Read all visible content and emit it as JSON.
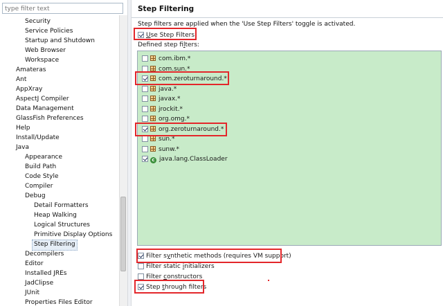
{
  "filter": {
    "placeholder": "type filter text"
  },
  "tree": {
    "items": [
      {
        "label": "Security",
        "level": 2
      },
      {
        "label": "Service Policies",
        "level": 2
      },
      {
        "label": "Startup and Shutdown",
        "level": 2
      },
      {
        "label": "Web Browser",
        "level": 2
      },
      {
        "label": "Workspace",
        "level": 2
      },
      {
        "label": "Amateras",
        "level": 1
      },
      {
        "label": "Ant",
        "level": 1
      },
      {
        "label": "AppXray",
        "level": 1
      },
      {
        "label": "AspectJ Compiler",
        "level": 1
      },
      {
        "label": "Data Management",
        "level": 1
      },
      {
        "label": "GlassFish Preferences",
        "level": 1
      },
      {
        "label": "Help",
        "level": 1
      },
      {
        "label": "Install/Update",
        "level": 1
      },
      {
        "label": "Java",
        "level": 1
      },
      {
        "label": "Appearance",
        "level": 2
      },
      {
        "label": "Build Path",
        "level": 2
      },
      {
        "label": "Code Style",
        "level": 2
      },
      {
        "label": "Compiler",
        "level": 2
      },
      {
        "label": "Debug",
        "level": 2
      },
      {
        "label": "Detail Formatters",
        "level": 3
      },
      {
        "label": "Heap Walking",
        "level": 3
      },
      {
        "label": "Logical Structures",
        "level": 3
      },
      {
        "label": "Primitive Display Options",
        "level": 3
      },
      {
        "label": "Step Filtering",
        "level": 3,
        "selected": true
      },
      {
        "label": "Decompilers",
        "level": 2
      },
      {
        "label": "Editor",
        "level": 2
      },
      {
        "label": "Installed JREs",
        "level": 2
      },
      {
        "label": "JadClipse",
        "level": 2
      },
      {
        "label": "JUnit",
        "level": 2
      },
      {
        "label": "Properties Files Editor",
        "level": 2
      }
    ]
  },
  "page": {
    "title": "Step Filtering",
    "description": "Step filters are applied when the 'Use Step Filters' toggle is activated.",
    "use_step_filters": {
      "pre": "",
      "ul": "U",
      "post": "se Step Filters",
      "checked": true
    },
    "defined_label": {
      "pre": "Defined step fi",
      "ul": "l",
      "post": "ters:"
    }
  },
  "filters": [
    {
      "label": "com.ibm.*",
      "checked": false,
      "icon": "package-icon"
    },
    {
      "label": "com.sun.*",
      "checked": false,
      "icon": "package-icon"
    },
    {
      "label": "com.zeroturnaround.*",
      "checked": true,
      "icon": "package-icon"
    },
    {
      "label": "java.*",
      "checked": false,
      "icon": "package-icon"
    },
    {
      "label": "javax.*",
      "checked": false,
      "icon": "package-icon"
    },
    {
      "label": "jrockit.*",
      "checked": false,
      "icon": "package-icon"
    },
    {
      "label": "org.omg.*",
      "checked": false,
      "icon": "package-icon"
    },
    {
      "label": "org.zeroturnaround.*",
      "checked": true,
      "icon": "package-icon"
    },
    {
      "label": "sun.*",
      "checked": false,
      "icon": "package-icon"
    },
    {
      "label": "sunw.*",
      "checked": false,
      "icon": "package-icon"
    },
    {
      "label": "java.lang.ClassLoader",
      "checked": true,
      "icon": "class-icon"
    }
  ],
  "options": [
    {
      "pre": "Filter s",
      "ul": "y",
      "post": "nthetic methods (requires VM support)",
      "checked": true
    },
    {
      "pre": "Filter static ",
      "ul": "i",
      "post": "nitializers",
      "checked": false
    },
    {
      "pre": "Filter ",
      "ul": "c",
      "post": "onstructors",
      "checked": false
    },
    {
      "pre": "Step ",
      "ul": "t",
      "post": "hrough filters",
      "checked": true
    }
  ],
  "colors": {
    "table_bg": "#c8ebc9",
    "highlight_red": "#e3262a",
    "selection_bg": "#e6eef7"
  }
}
